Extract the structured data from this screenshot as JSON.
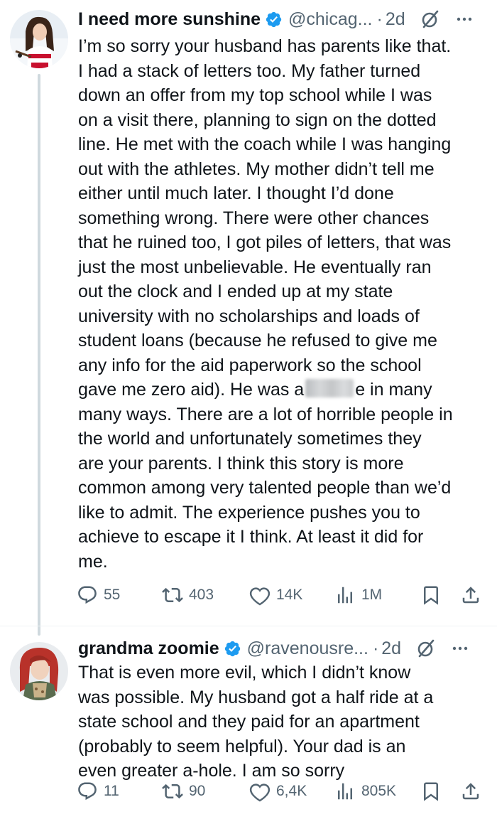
{
  "tweets": [
    {
      "author": {
        "name": "I need more sunshine",
        "handle": "@chicag...",
        "time": "2d"
      },
      "text_lines": [
        "I’m so sorry your husband has parents like that.",
        "I had a stack of letters too. My father turned",
        "down an offer from my top school while I was",
        "on a visit there, planning to sign on the dotted",
        "line. He met with the coach while I was hanging",
        "out with the athletes. My mother didn’t tell me",
        "either until much later. I thought I’d done",
        "something wrong. There were other chances",
        "that he ruined too, I got piles of letters, that was",
        "just the most unbelievable. He eventually ran",
        "out the clock and I ended up at my state",
        "university with no scholarships and loads of",
        "student loans (because he refused to give me",
        "any info for the aid paperwork so the school",
        "gave me zero aid). He was a",
        "e in many",
        "many ways. There are a lot of horrible people in",
        "the world and unfortunately sometimes they",
        "are your parents. I think this story is more",
        "common among very talented people than we’d",
        "like to admit. The experience pushes you to",
        "achieve to escape it I think. At least it did for",
        "me."
      ],
      "metrics": {
        "replies": "55",
        "reposts": "403",
        "likes": "14K",
        "views": "1M"
      }
    },
    {
      "author": {
        "name": "grandma zoomie",
        "handle": "@ravenousre...",
        "time": "2d"
      },
      "text_lines": [
        "That is even more evil, which I didn’t know",
        "was possible. My husband got a half ride at a",
        "state school and they paid for an apartment",
        "(probably to seem helpful). Your dad is an",
        "even greater a-hole. I am so sorry"
      ],
      "metrics": {
        "replies": "11",
        "reposts": "90",
        "likes": "6,4K",
        "views": "805K"
      }
    }
  ],
  "colors": {
    "text": "#0f1419",
    "secondary": "#536471",
    "verified_blue": "#1d9bf0",
    "thread_line": "#cfd9de",
    "divider": "#eff3f4"
  },
  "icons": {
    "verified": "verified-badge-icon",
    "grok": "grok-icon",
    "more": "more-icon",
    "reply": "reply-icon",
    "repost": "repost-icon",
    "like": "heart-icon",
    "views": "views-icon",
    "bookmark": "bookmark-icon",
    "share": "share-icon"
  }
}
